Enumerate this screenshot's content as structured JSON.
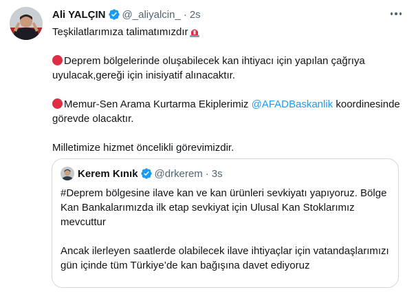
{
  "tweet": {
    "author_name": "Ali YALÇIN",
    "author_handle": "@_aliyalcin_",
    "time": "2s",
    "line1": "Teşkilatlarımıza talimatımızdır",
    "para1": "Deprem bölgelerinde oluşabilecek kan ihtiyacı için yapılan çağrıya uyulacak,gereği için inisiyatif alınacaktır.",
    "para2_prefix": "Memur-Sen Arama Kurtarma Ekiplerimiz ",
    "para2_mention": "@AFADBaskanlik",
    "para2_suffix": " koordinesinde görevde olacaktır.",
    "para3": "Milletimize hizmet öncelikli görevimizdir.",
    "icons": {
      "more": "more-horizontal-icon",
      "verified": "verified-badge-icon",
      "siren": "rotating-light-emoji",
      "bullet": "red-circle-emoji"
    },
    "colors": {
      "verified": "#1d9bf0",
      "mention": "#1d9bf0",
      "bullet": "#dd2e44",
      "muted": "#536471"
    }
  },
  "quote": {
    "author_name": "Kerem Kınık",
    "author_handle": "@drkerem",
    "time": "3s",
    "para1": "#Deprem bölgesine ilave kan ve kan ürünleri sevkiyatı yapıyoruz. Bölge Kan Bankalarımızda ilk etap sevkiyat için Ulusal Kan Stoklarımız mevcuttur",
    "para2": "Ancak ilerleyen saatlerde olabilecek ilave ihtiyaçlar için vatandaşlarımızı gün içinde tüm Türkiye’de kan bağışına davet ediyoruz"
  }
}
